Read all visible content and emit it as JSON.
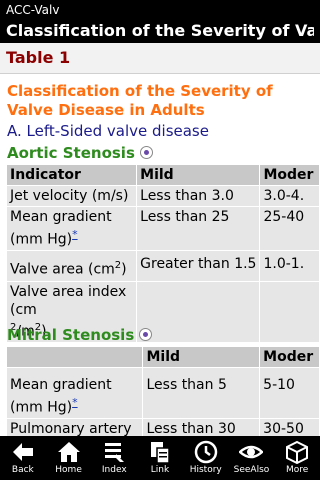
{
  "header": {
    "app_name": "ACC-Valv",
    "title": "Classification of the Severity of Valve..."
  },
  "table_heading": "Table 1",
  "content": {
    "title": "Classification of the Severity of Valve Disease in Adults",
    "section": "A. Left-Sided valve disease",
    "aortic": {
      "title": "Aortic Stenosis",
      "columns": [
        "Indicator",
        "Mild",
        "Moder"
      ],
      "rows": [
        {
          "indicator": "Jet velocity (m/s)",
          "mild": "Less than 3.0",
          "moderate": "3.0-4."
        },
        {
          "indicator": "Mean gradient (mm Hg)",
          "footnote": "*",
          "mild": "Less than 25",
          "moderate": "25-40"
        },
        {
          "indicator": "Valve area (cm",
          "sup": "2",
          "indicator_end": ")",
          "mild": "Greater than 1.5",
          "moderate": "1.0-1."
        },
        {
          "indicator_html_parts": [
            "Valve area index (cm",
            "2",
            "/m",
            "2",
            ")"
          ],
          "mild": "",
          "moderate": ""
        }
      ]
    },
    "mitral": {
      "title": "Mitral Stenosis",
      "columns": [
        "",
        "Mild",
        "Moder"
      ],
      "rows": [
        {
          "indicator": "Mean gradient (mm Hg)",
          "footnote": "*",
          "mild": "Less than 5",
          "moderate": "5-10"
        },
        {
          "indicator": "Pulmonary artery",
          "mild": "Less than 30",
          "moderate": "30-50"
        }
      ]
    }
  },
  "toolbar": {
    "back": "Back",
    "home": "Home",
    "index": "Index",
    "link": "Link",
    "history": "History",
    "seealso": "SeeAlso",
    "more": "More"
  }
}
